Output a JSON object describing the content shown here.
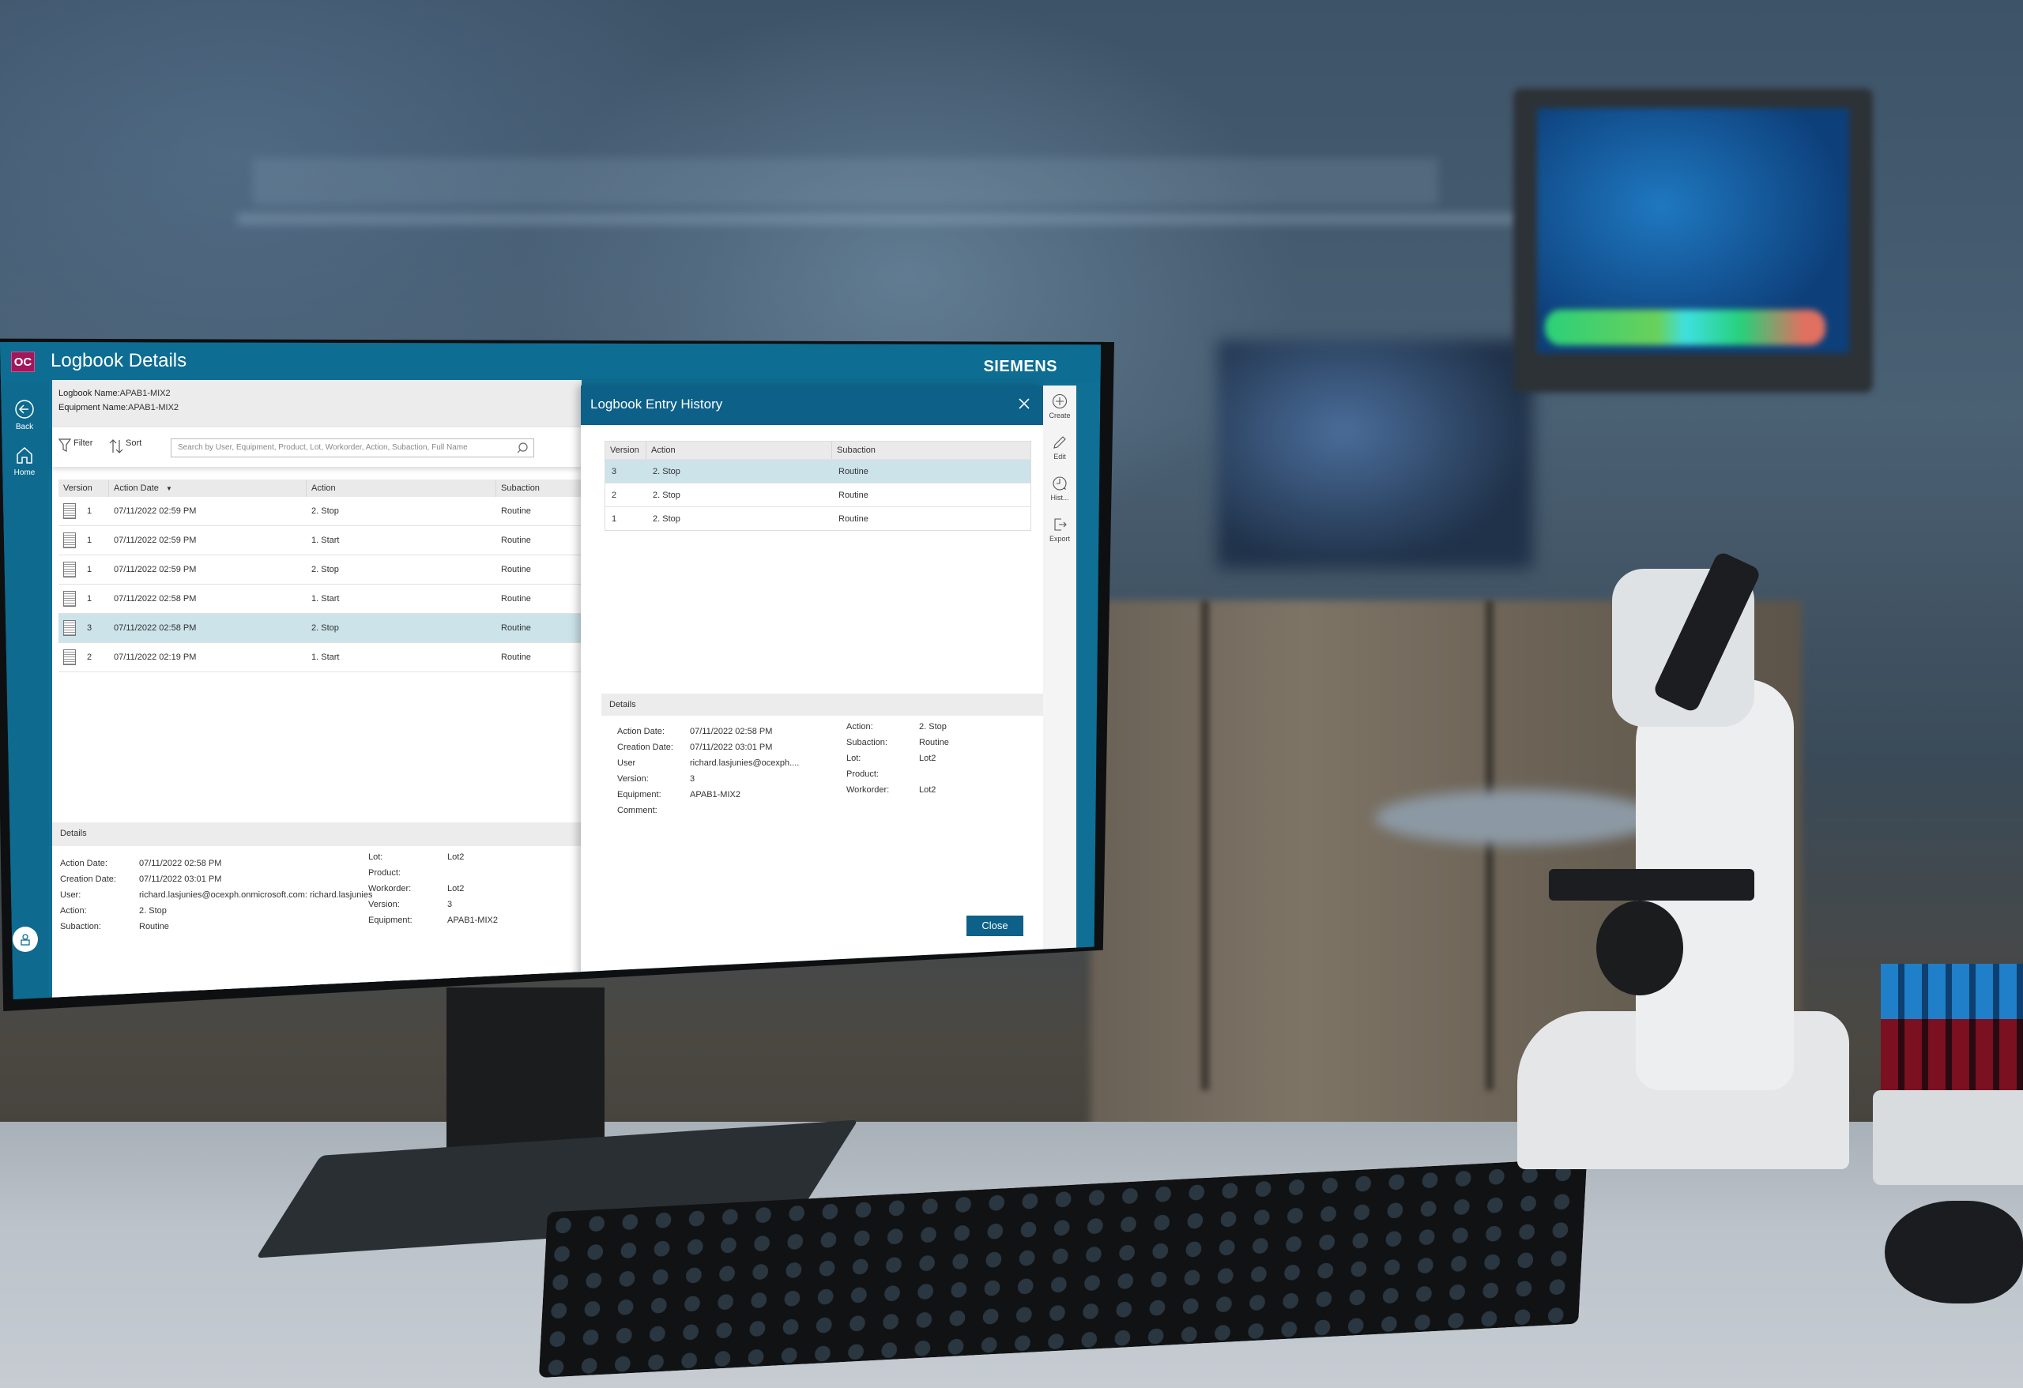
{
  "app": {
    "logo_text": "OC",
    "title": "Logbook Details",
    "brand": "SIEMENS"
  },
  "sidebar": {
    "items": [
      {
        "label": "Back",
        "icon": "back-arrow-icon"
      },
      {
        "label": "Home",
        "icon": "home-icon"
      }
    ],
    "user_icon": "user-avatar-icon"
  },
  "logbook_info": {
    "logbook_name_label": "Logbook Name:",
    "logbook_name": "APAB1-MIX2",
    "equipment_name_label": "Equipment Name:",
    "equipment_name": "APAB1-MIX2"
  },
  "toolbar": {
    "filter_label": "Filter",
    "sort_label": "Sort",
    "search_placeholder": "Search by User, Equipment, Product, Lot, Workorder, Action, Subaction, Full Name"
  },
  "grid": {
    "columns": [
      "Version",
      "Action Date",
      "Action",
      "Subaction"
    ],
    "sort_indicator": "▼",
    "rows": [
      {
        "version": "1",
        "action_date": "07/11/2022 02:59 PM",
        "action": "2. Stop",
        "subaction": "Routine",
        "selected": false
      },
      {
        "version": "1",
        "action_date": "07/11/2022 02:59 PM",
        "action": "1. Start",
        "subaction": "Routine",
        "selected": false
      },
      {
        "version": "1",
        "action_date": "07/11/2022 02:59 PM",
        "action": "2. Stop",
        "subaction": "Routine",
        "selected": false
      },
      {
        "version": "1",
        "action_date": "07/11/2022 02:58 PM",
        "action": "1. Start",
        "subaction": "Routine",
        "selected": false
      },
      {
        "version": "3",
        "action_date": "07/11/2022 02:58 PM",
        "action": "2. Stop",
        "subaction": "Routine",
        "selected": true
      },
      {
        "version": "2",
        "action_date": "07/11/2022 02:19 PM",
        "action": "1. Start",
        "subaction": "Routine",
        "selected": false
      }
    ]
  },
  "details": {
    "header": "Details",
    "left": [
      {
        "label": "Action Date:",
        "value": "07/11/2022 02:58 PM"
      },
      {
        "label": "Creation Date:",
        "value": "07/11/2022 03:01 PM"
      },
      {
        "label": "User:",
        "value": "richard.lasjunies@ocexph.onmicrosoft.com: richard.lasjunies"
      },
      {
        "label": "Action:",
        "value": "2. Stop"
      },
      {
        "label": "Subaction:",
        "value": "Routine"
      }
    ],
    "right": [
      {
        "label": "Lot:",
        "value": "Lot2"
      },
      {
        "label": "Product:",
        "value": ""
      },
      {
        "label": "Workorder:",
        "value": "Lot2"
      },
      {
        "label": "Version:",
        "value": "3"
      },
      {
        "label": "Equipment:",
        "value": "APAB1-MIX2"
      }
    ]
  },
  "history": {
    "title": "Logbook Entry History",
    "columns": [
      "Version",
      "Action",
      "Subaction"
    ],
    "rows": [
      {
        "version": "3",
        "action": "2. Stop",
        "subaction": "Routine",
        "selected": true
      },
      {
        "version": "2",
        "action": "2. Stop",
        "subaction": "Routine",
        "selected": false
      },
      {
        "version": "1",
        "action": "2. Stop",
        "subaction": "Routine",
        "selected": false
      }
    ],
    "details_header": "Details",
    "details_left": [
      {
        "label": "Action Date:",
        "value": "07/11/2022 02:58 PM"
      },
      {
        "label": "Creation Date:",
        "value": "07/11/2022 03:01 PM"
      },
      {
        "label": "User",
        "value": "richard.lasjunies@ocexph...."
      },
      {
        "label": "Version:",
        "value": "3"
      },
      {
        "label": "Equipment:",
        "value": "APAB1-MIX2"
      },
      {
        "label": "Comment:",
        "value": ""
      }
    ],
    "details_right": [
      {
        "label": "Action:",
        "value": "2. Stop"
      },
      {
        "label": "Subaction:",
        "value": "Routine"
      },
      {
        "label": "Lot:",
        "value": "Lot2"
      },
      {
        "label": "Product:",
        "value": ""
      },
      {
        "label": "Workorder:",
        "value": "Lot2"
      }
    ],
    "close_label": "Close"
  },
  "actionbar": {
    "items": [
      {
        "label": "Create",
        "icon": "plus-circle-icon"
      },
      {
        "label": "Edit",
        "icon": "pencil-icon"
      },
      {
        "label": "Hist...",
        "icon": "history-clock-icon"
      },
      {
        "label": "Export",
        "icon": "export-icon"
      }
    ]
  },
  "colors": {
    "primary": "#0e6d93",
    "header_dark": "#0d6088",
    "selected_row": "#cce3ea",
    "logo": "#a0185a"
  }
}
